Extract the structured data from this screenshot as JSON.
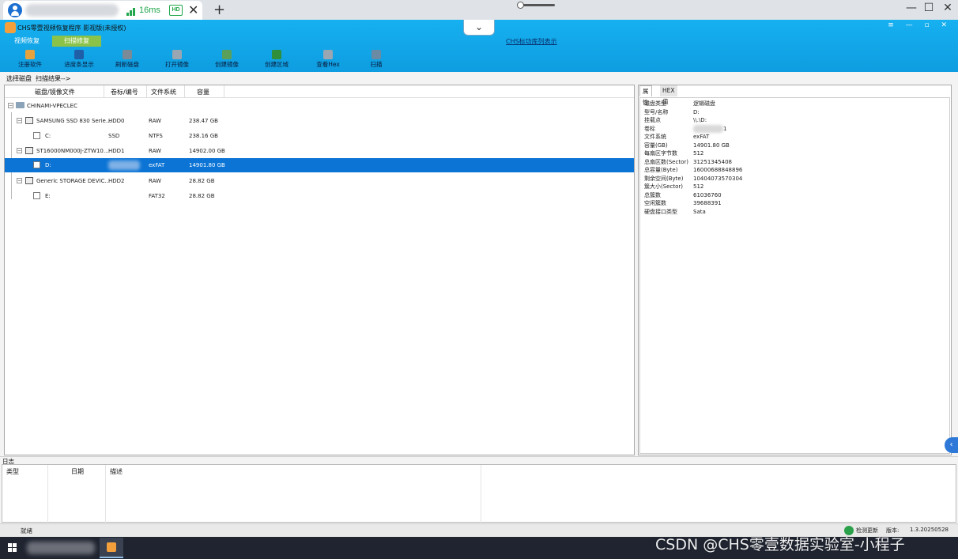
{
  "remote_bar": {
    "latency": "16ms",
    "hd_badge": "HD",
    "close_tab": "✕",
    "new_tab": "+",
    "window_controls": [
      "—",
      "☐",
      "✕"
    ]
  },
  "app": {
    "title": "CHS零壹视频恢复程序 影视版(未授权)",
    "center_link": "CHS标功库列表示",
    "window_controls": "≡ — ▫ ✕",
    "dropdown_glyph": "⌄",
    "modes": [
      {
        "label": "视频恢复",
        "active": false
      },
      {
        "label": "扫描修复",
        "active": true
      }
    ],
    "toolbar": [
      {
        "label": "注册软件",
        "icon": "key-icon",
        "color": "#e6a23c"
      },
      {
        "label": "进度条显示",
        "icon": "monitor-icon",
        "color": "#1e5fa8"
      },
      {
        "label": "刷新磁盘",
        "icon": "refresh-disk-icon",
        "color": "#7a8a96"
      },
      {
        "label": "打开镜像",
        "icon": "open-image-icon",
        "color": "#9aa6b2"
      },
      {
        "label": "创建镜像",
        "icon": "create-image-icon",
        "color": "#5aa05a"
      },
      {
        "label": "创建区域",
        "icon": "create-region-icon",
        "color": "#2f8f3a"
      },
      {
        "label": "查看Hex",
        "icon": "hex-view-icon",
        "color": "#9aa6b2"
      },
      {
        "label": "扫描",
        "icon": "scan-icon",
        "color": "#6b8aa3"
      }
    ],
    "breadcrumb": {
      "select_disk": "选择磁盘",
      "scan_result": "扫描结果-->"
    }
  },
  "disk_table": {
    "columns": [
      "磁盘/镜像文件",
      "卷标/编号",
      "文件系统",
      "容量"
    ],
    "root": {
      "label": "CHINAMI-VPECLEC",
      "toggle": "−"
    },
    "rows": [
      {
        "name": "SAMSUNG SSD 830 Serie...",
        "id": "HDD0",
        "fs": "RAW",
        "size": "238.47 GB",
        "level": 1,
        "kind": "disk",
        "toggle": "−",
        "selected": false
      },
      {
        "name": "C:",
        "id": "SSD",
        "fs": "NTFS",
        "size": "238.16 GB",
        "level": 2,
        "kind": "part",
        "toggle": "",
        "selected": false
      },
      {
        "name": "ST16000NM000J-ZTW10...",
        "id": "HDD1",
        "fs": "RAW",
        "size": "14902.00 GB",
        "level": 1,
        "kind": "disk",
        "toggle": "−",
        "selected": false
      },
      {
        "name": "D:",
        "id": "",
        "fs": "exFAT",
        "size": "14901.80 GB",
        "level": 2,
        "kind": "part",
        "toggle": "",
        "selected": true
      },
      {
        "name": "Generic STORAGE DEVIC...",
        "id": "HDD2",
        "fs": "RAW",
        "size": "28.82 GB",
        "level": 1,
        "kind": "disk",
        "toggle": "−",
        "selected": false
      },
      {
        "name": "E:",
        "id": "",
        "fs": "FAT32",
        "size": "28.82 GB",
        "level": 2,
        "kind": "part",
        "toggle": "",
        "selected": false
      }
    ]
  },
  "properties": {
    "tabs": [
      {
        "label": "属性",
        "active": true
      },
      {
        "label": "HEX值",
        "active": false
      }
    ],
    "rows": [
      {
        "key": "磁盘类型",
        "value": "逻辑磁盘"
      },
      {
        "key": "型号/名称",
        "value": "D:"
      },
      {
        "key": "挂载点",
        "value": "\\\\.\\D:"
      },
      {
        "key": "卷标",
        "value": "1"
      },
      {
        "key": "文件系统",
        "value": "exFAT"
      },
      {
        "key": "容量(GB)",
        "value": "14901.80 GB"
      },
      {
        "key": "每扇区字节数",
        "value": "512"
      },
      {
        "key": "总扇区数(Sector)",
        "value": "31251345408"
      },
      {
        "key": "总容量(Byte)",
        "value": "16000688848896"
      },
      {
        "key": "剩余空间(Byte)",
        "value": "10404073570304"
      },
      {
        "key": "簇大小(Sector)",
        "value": "512"
      },
      {
        "key": "总簇数",
        "value": "61036760"
      },
      {
        "key": "空闲簇数",
        "value": "39688391"
      },
      {
        "key": "硬盘接口类型",
        "value": "Sata"
      }
    ],
    "collapse_handle": "‹"
  },
  "log": {
    "title": "日志",
    "columns": [
      "类型",
      "日期",
      "描述"
    ]
  },
  "status": {
    "left": "就绪",
    "update": "检测更新",
    "version_label": "版本:",
    "version": "1.3.20250528"
  },
  "watermark": "CSDN @CHS零壹数据实验室-小程子"
}
